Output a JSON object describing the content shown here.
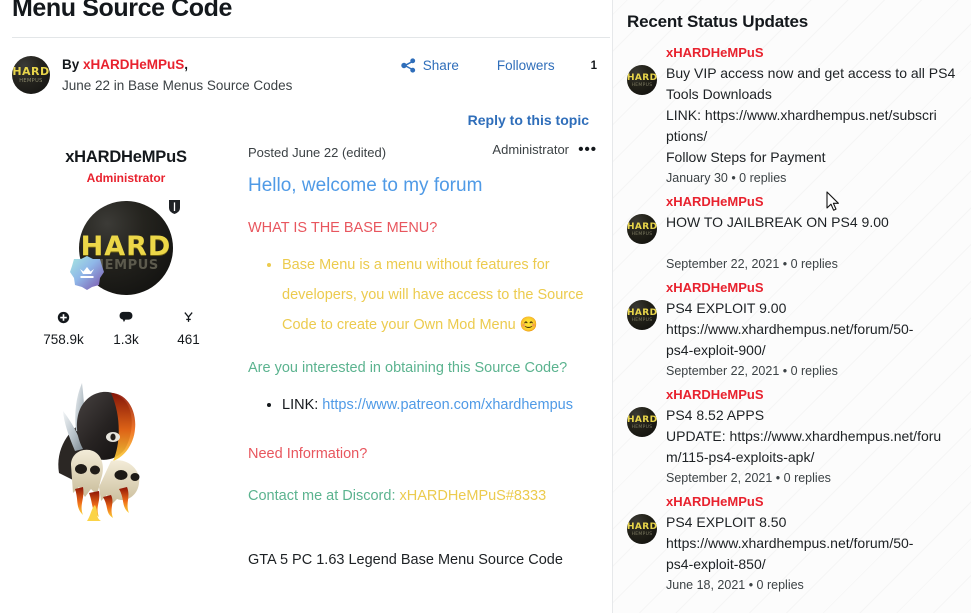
{
  "topic": {
    "title": "Menu Source Code",
    "byline_prefix": "By",
    "byline_author": "xHARDHeMPuS",
    "byline_comma": ",",
    "byline_meta": "June 22 in Base Menus Source Codes",
    "share_label": "Share",
    "followers_label": "Followers",
    "followers_count": "1",
    "reply_label": "Reply to this topic"
  },
  "post": {
    "author_name": "xHARDHeMPuS",
    "author_rank": "Administrator",
    "avatar_text_main": "HARD",
    "avatar_text_sub": "HEMPUS",
    "stats": [
      {
        "icon": "plus-circle-icon",
        "value": "758.9k"
      },
      {
        "icon": "comment-icon",
        "value": "1.3k"
      },
      {
        "icon": "reputation-icon",
        "value": "461"
      }
    ],
    "posted": "Posted June 22 (edited)",
    "rank_right": "Administrator",
    "more_dots": "•••",
    "content": {
      "greeting": "Hello, welcome to my forum",
      "heading_1": "WHAT IS THE BASE MENU?",
      "bullet_1": "Base Menu is a menu without features for developers, you will have access to the Source Code to create your Own Mod Menu 😊",
      "heading_2": "Are you interested in obtaining this Source Code?",
      "bullet_2_label": "LINK: ",
      "bullet_2_link": "https://www.patreon.com/xhardhempus",
      "heading_3": "Need Information?",
      "contact_label": "Contact me at Discord: ",
      "contact_handle": "xHARDHeMPuS#8333",
      "footer_line": "GTA 5 PC 1.63 Legend Base Menu Source Code"
    }
  },
  "sidebar": {
    "title": "Recent Status Updates",
    "updates": [
      {
        "user": "xHARDHeMPuS",
        "lines": [
          "Buy VIP access now and get access to all PS4",
          "Tools Downloads",
          "LINK: https://www.xhardhempus.net/subscri",
          "ptions/",
          "Follow Steps for Payment"
        ],
        "meta": "January 30 • 0 replies"
      },
      {
        "user": "xHARDHeMPuS",
        "lines": [
          "HOW TO JAILBREAK ON PS4 9.00",
          ""
        ],
        "meta": "September 22, 2021 • 0 replies"
      },
      {
        "user": "xHARDHeMPuS",
        "lines": [
          "PS4 EXPLOIT 9.00",
          "https://www.xhardhempus.net/forum/50-",
          "ps4-exploit-900/"
        ],
        "meta": "September 22, 2021 • 0 replies"
      },
      {
        "user": "xHARDHeMPuS",
        "lines": [
          "PS4 8.52 APPS",
          "UPDATE: https://www.xhardhempus.net/foru",
          "m/115-ps4-exploits-apk/"
        ],
        "meta": "September 2, 2021 • 0 replies"
      },
      {
        "user": "xHARDHeMPuS",
        "lines": [
          "PS4 EXPLOIT 8.50",
          "https://www.xhardhempus.net/forum/50-",
          "ps4-exploit-850/"
        ],
        "meta": "June 18, 2021 • 0 replies"
      }
    ]
  },
  "colors": {
    "accent_red": "#e8222e",
    "link_blue": "#2f6eba",
    "soft_blue": "#4f9ae6",
    "heading_red": "#e8565e",
    "gold": "#eccb4e",
    "green": "#5bb38f"
  }
}
